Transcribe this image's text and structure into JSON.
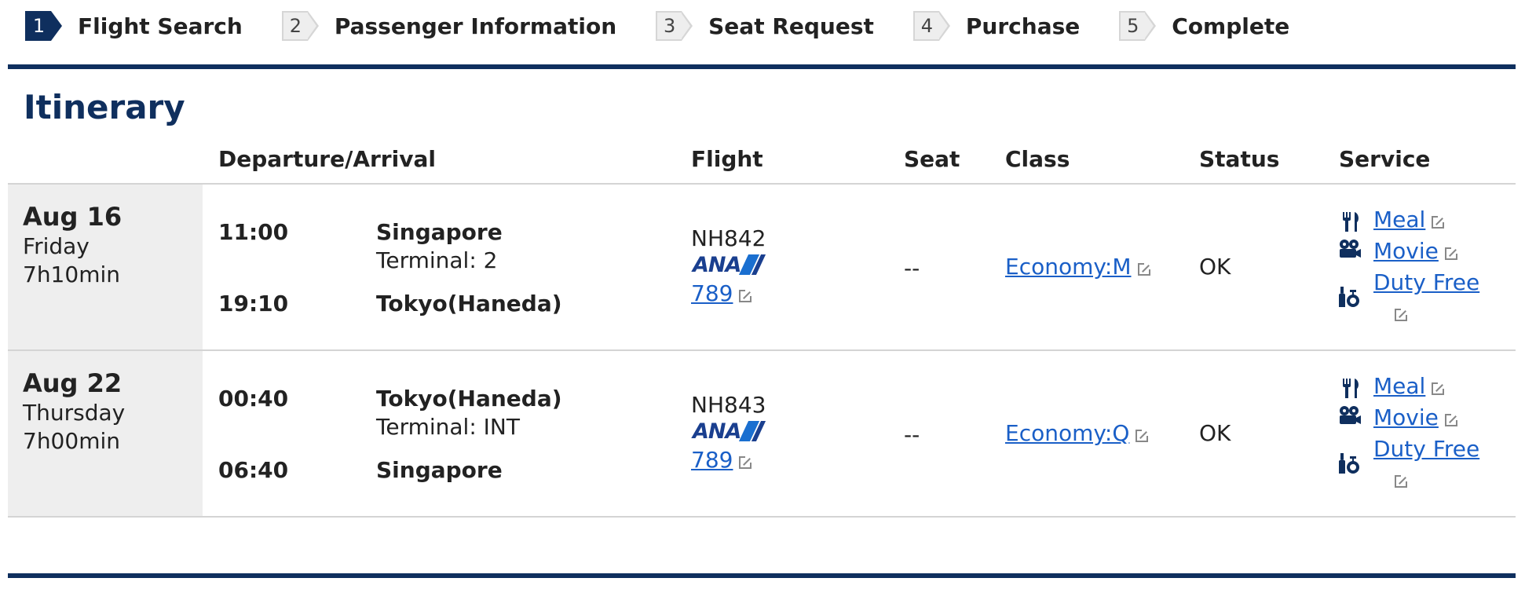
{
  "steps": [
    {
      "num": "1",
      "label": "Flight Search",
      "active": true
    },
    {
      "num": "2",
      "label": "Passenger Information",
      "active": false
    },
    {
      "num": "3",
      "label": "Seat Request",
      "active": false
    },
    {
      "num": "4",
      "label": "Purchase",
      "active": false
    },
    {
      "num": "5",
      "label": "Complete",
      "active": false
    }
  ],
  "itinerary": {
    "title": "Itinerary",
    "headers": {
      "dep_arr": "Departure/Arrival",
      "flight": "Flight",
      "seat": "Seat",
      "class": "Class",
      "status": "Status",
      "service": "Service"
    },
    "rows": [
      {
        "date": "Aug 16",
        "weekday": "Friday",
        "duration": "7h10min",
        "dep_time": "11:00",
        "dep_city": "Singapore",
        "dep_terminal": "Terminal: 2",
        "arr_time": "19:10",
        "arr_city": "Tokyo(Haneda)",
        "flight_no": "NH842",
        "airline_logo": "ANA",
        "aircraft": "789",
        "seat": "--",
        "class": "Economy:M",
        "status": "OK",
        "services": {
          "meal": "Meal",
          "movie": "Movie",
          "duty_free": "Duty Free"
        }
      },
      {
        "date": "Aug 22",
        "weekday": "Thursday",
        "duration": "7h00min",
        "dep_time": "00:40",
        "dep_city": "Tokyo(Haneda)",
        "dep_terminal": "Terminal: INT",
        "arr_time": "06:40",
        "arr_city": "Singapore",
        "flight_no": "NH843",
        "airline_logo": "ANA",
        "aircraft": "789",
        "seat": "--",
        "class": "Economy:Q",
        "status": "OK",
        "services": {
          "meal": "Meal",
          "movie": "Movie",
          "duty_free": "Duty Free"
        }
      }
    ]
  },
  "colors": {
    "brand_navy": "#0f2f5e",
    "link_blue": "#1a5fc7",
    "date_cell_bg": "#eeeeee"
  },
  "icons": [
    "meal-icon",
    "movie-icon",
    "duty-free-icon",
    "external-link-icon"
  ]
}
